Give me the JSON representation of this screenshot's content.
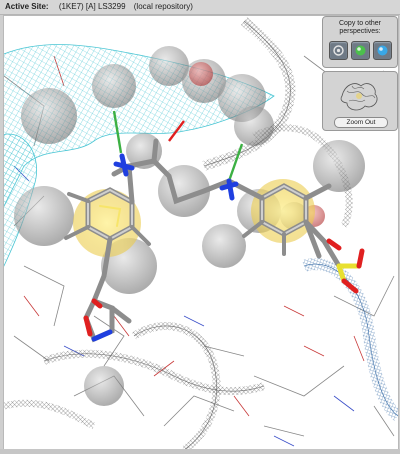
{
  "header": {
    "label": "Active Site:",
    "structure_id": "(1KE7) [A] LS3299",
    "source": "(local repository)"
  },
  "perspectives_panel": {
    "title": "Copy to other perspectives:",
    "buttons": [
      {
        "icon": "gear-perspective-icon"
      },
      {
        "icon": "green-sphere-perspective-icon"
      },
      {
        "icon": "blue-sphere-perspective-icon"
      }
    ]
  },
  "zoom_panel": {
    "thumbnail_icon": "protein-overview-thumbnail",
    "zoom_out_label": "Zoom Out"
  },
  "colors": {
    "background": "#ffffff",
    "cyan_mesh": "#4bc6d4",
    "gray_mesh": "#6a6a6a",
    "aromatic_highlight": "#f0d45a",
    "nitrogen": "#1f3fe0",
    "oxygen": "#e02020",
    "sulfur": "#e8e030",
    "carbon": "#9a9a9a",
    "hbond": "#3cb043"
  }
}
